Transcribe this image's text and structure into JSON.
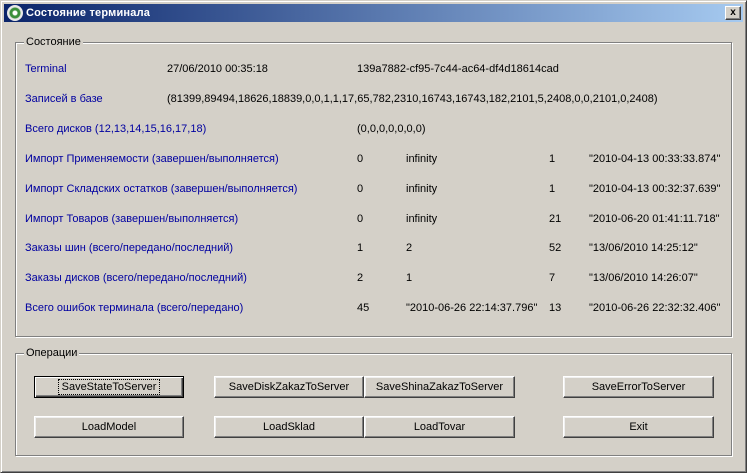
{
  "window": {
    "title": "Состояние терминала",
    "close_label": "x"
  },
  "status": {
    "legend": "Состояние",
    "rows": [
      {
        "label": "Terminal",
        "cells": [
          "27/06/2010 00:35:18",
          "139a7882-cf95-7c44-ac64-df4d18614cad"
        ]
      },
      {
        "label": "Записей в базе",
        "cells": [
          "(81399,89494,18626,18839,0,0,1,1,17,65,782,2310,16743,16743,182,2101,5,2408,0,0,2101,0,2408)"
        ]
      },
      {
        "label": "Всего дисков (12,13,14,15,16,17,18)",
        "cells": [
          "(0,0,0,0,0,0,0)"
        ]
      },
      {
        "label": "Импорт Применяемости (завершен/выполняется)",
        "cells": [
          "0",
          "infinity",
          "1",
          "\"2010-04-13 00:33:33.874\""
        ]
      },
      {
        "label": "Импорт Складских остатков  (завершен/выполняется)",
        "cells": [
          "0",
          "infinity",
          "1",
          "\"2010-04-13 00:32:37.639\""
        ]
      },
      {
        "label": "Импорт Товаров  (завершен/выполняется)",
        "cells": [
          "0",
          "infinity",
          "21",
          "\"2010-06-20 01:41:11.718\""
        ]
      },
      {
        "label": "Заказы шин (всего/передано/последний)",
        "cells": [
          "1",
          "2",
          "52",
          "\"13/06/2010 14:25:12\""
        ]
      },
      {
        "label": "Заказы дисков (всего/передано/последний)",
        "cells": [
          "2",
          "1",
          "7",
          "\"13/06/2010 14:26:07\""
        ]
      },
      {
        "label": "Всего ошибок терминала (всего/передано)",
        "cells": [
          "45",
          "\"2010-06-26 22:14:37.796\"",
          "13",
          "\"2010-06-26 22:32:32.406\""
        ]
      }
    ]
  },
  "operations": {
    "legend": "Операции",
    "buttons": [
      {
        "label": "SaveStateToServer"
      },
      {
        "label": "SaveDiskZakazToServer"
      },
      {
        "label": "SaveShinaZakazToServer"
      },
      {
        "label": "SaveErrorToServer"
      },
      {
        "label": "LoadModel"
      },
      {
        "label": "LoadSklad"
      },
      {
        "label": "LoadTovar"
      },
      {
        "label": "Exit"
      }
    ]
  },
  "colors": {
    "label_text": "#0000a0",
    "titlebar_start": "#0a246a",
    "titlebar_end": "#a6caf0",
    "face": "#d4d0c8"
  }
}
